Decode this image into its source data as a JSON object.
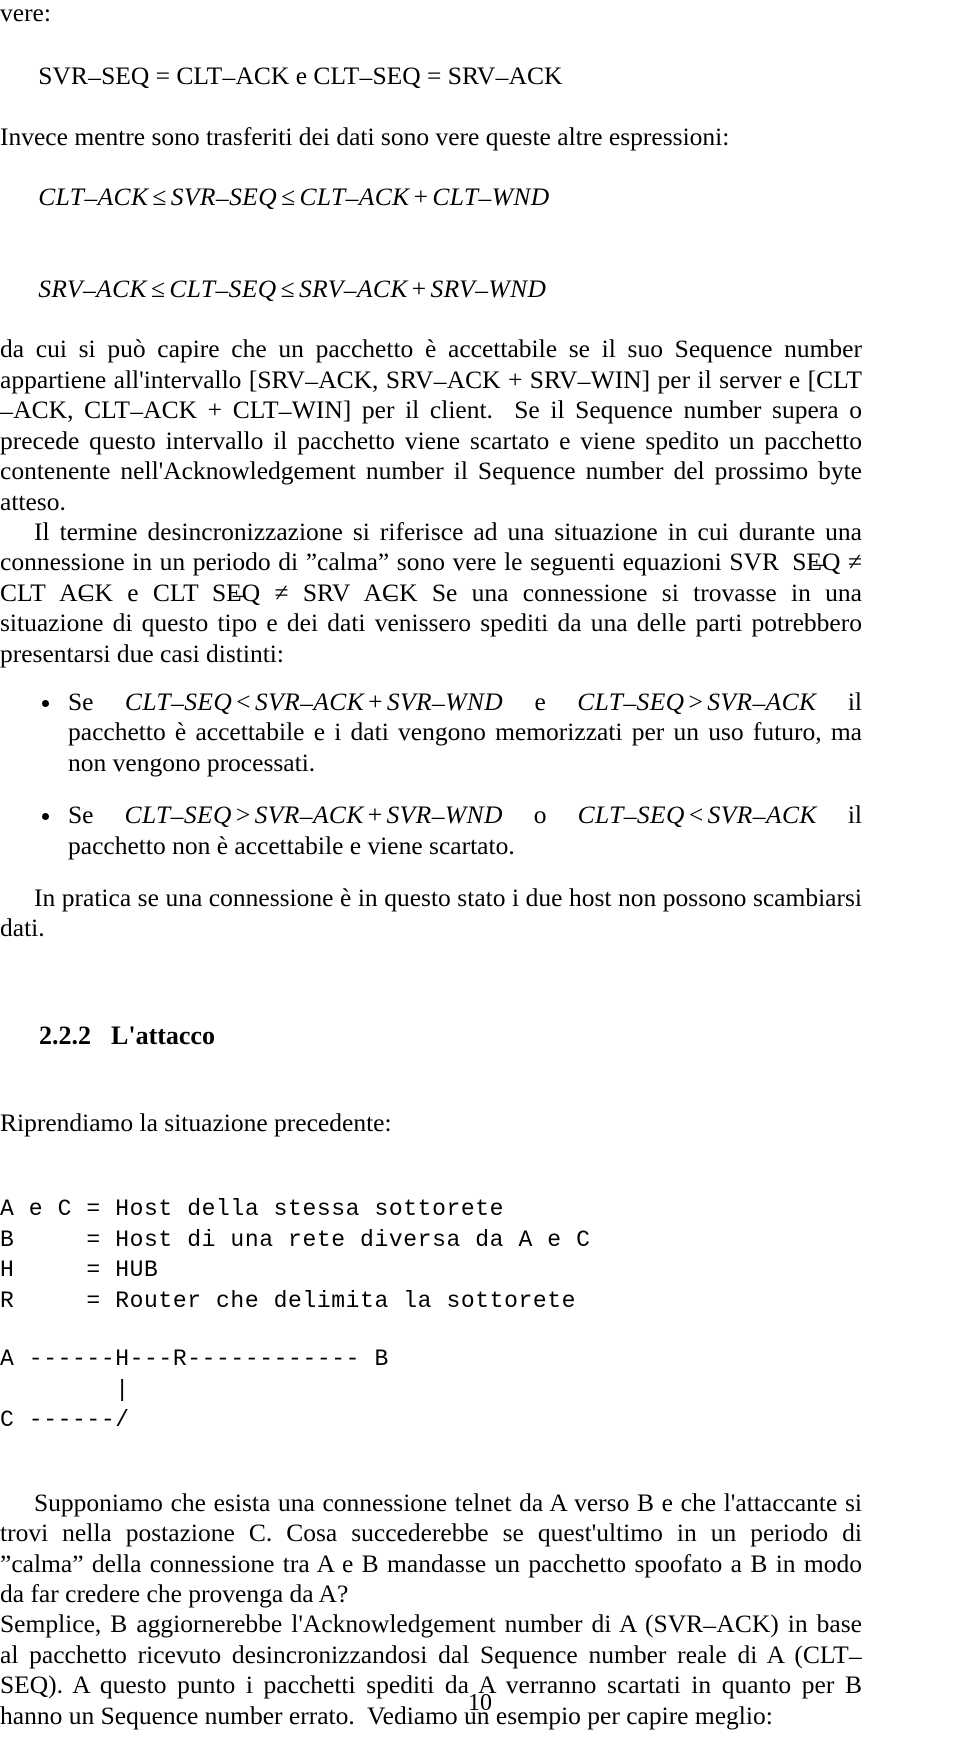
{
  "document": {
    "language": "it",
    "page_number": "10",
    "section": {
      "number": "2.2.2",
      "title": "L'attacco"
    }
  },
  "top": {
    "line_vere": "vere:",
    "eq_equalities": "SVR_SEQ = CLT_ACK e CLT_SEQ = SRV_ACK",
    "line_invece": "Invece mentre sono trasferiti dei dati sono vere queste altre espressioni:",
    "display_math_1": "CLT_ACK ≤ SVR_SEQ ≤ CLT_ACK + CLT_WND",
    "display_math_2": "SRV_ACK ≤ CLT_SEQ ≤ SRV_ACK + SRV_WND"
  },
  "paragraphs": {
    "accettabile": "da cui si può capire che un pacchetto è accettabile se il suo Sequence number appartiene all'intervallo [SRV_ACK, SRV_ACK + SRV_WIN] per il server e [CLT_ACK, CLT_ACK + CLT_WIN] per il client.  Se il Sequence number supera o precede questo intervallo il pacchetto viene scartato e viene spedito un pacchetto contenente nell'Acknowledgement number il Sequence number del prossimo byte atteso.",
    "desincronizzazione": "Il termine desincronizzazione si riferisce ad una situazione in cui durante una connessione in un periodo di \"calma\" sono vere le seguenti equazioni SVR_SEQ ≠ CLT_ACK e CLT_SEQ ≠ SRV_ACK Se una connessione si trovasse in una situazione di questo tipo e dei dati venissero spediti da una delle parti potrebbero presentarsi due casi distinti:",
    "in_pratica": "In pratica se una connessione è in questo stato i due host non possono scambiarsi dati.",
    "riprendiamo": "Riprendiamo la situazione precedente:",
    "supponiamo": "Supponiamo che esista una connessione telnet da A verso B e che l'attaccante si trovi nella postazione C. Cosa succederebbe se quest'ultimo in un periodo di \"calma\" della connessione tra A e B mandasse un pacchetto spoofato a B in modo da far credere che provenga da A?",
    "semplice": "Semplice, B aggiornerebbe l'Acknowledgement number di A (SVR_ACK) in base al pacchetto ricevuto desincronizzandosi dal Sequence number reale di A (CLT_SEQ). A questo punto i pacchetti spediti da A verranno scartati in quanto per B hanno un Sequence number errato.  Vediamo un esempio per capire meglio:"
  },
  "bullets": [
    {
      "math": "Se CLT_SEQ < SVR_ACK + SVR_WND e CLT_SEQ > SVR_ACK",
      "text": "il pacchetto è accettabile e i dati vengono memorizzati per un uso futuro, ma non vengono processati."
    },
    {
      "math": "Se CLT_SEQ > SVR_ACK + SVR_WND o CLT_SEQ < SVR_ACK",
      "text": "il pacchetto non è accettabile e viene scartato."
    }
  ],
  "legend": {
    "lines": [
      "A e C = Host della stessa sottorete",
      "B     = Host di una rete diversa da A e C",
      "H     = HUB",
      "R     = Router che delimita la sottorete"
    ]
  },
  "diagram": {
    "lines": [
      "A ------H---R------------ B",
      "        |",
      "C ------/"
    ]
  }
}
